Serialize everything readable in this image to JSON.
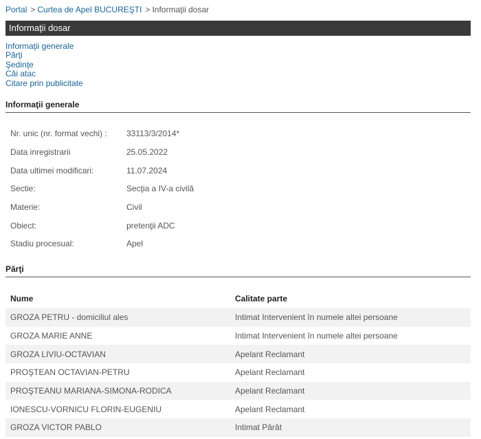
{
  "breadcrumb": {
    "portal": "Portal",
    "separator": ">",
    "court": "Curtea de Apel BUCUREŞTI",
    "current": "Informaţii dosar"
  },
  "title": "Informaţii dosar",
  "quick_links": [
    "Informaţii generale",
    "Părţi",
    "Şedinţe",
    "Căi atac",
    "Citare prin publicitate"
  ],
  "general": {
    "heading": "Informaţii generale",
    "rows": [
      {
        "label": "Nr. unic (nr. format vechi) :",
        "value": "33113/3/2014*"
      },
      {
        "label": "Data inregistrarii",
        "value": "25.05.2022"
      },
      {
        "label": "Data ultimei modificari:",
        "value": "11.07.2024"
      },
      {
        "label": "Sectie:",
        "value": "Secţia a IV-a civilă"
      },
      {
        "label": "Materie:",
        "value": "Civil"
      },
      {
        "label": "Obiect:",
        "value": "pretenţii ADC"
      },
      {
        "label": "Stadiu procesual:",
        "value": "Apel"
      }
    ]
  },
  "parti": {
    "heading": "Părţi",
    "columns": [
      "Nume",
      "Calitate parte"
    ],
    "rows": [
      {
        "name": "GROZA PETRU - domiciliul ales",
        "role": "Intimat Intervenient în numele altei persoane"
      },
      {
        "name": "GROZA MARIE ANNE",
        "role": "Intimat Intervenient în numele altei persoane"
      },
      {
        "name": "GROZA LIVIU-OCTAVIAN",
        "role": "Apelant Reclamant"
      },
      {
        "name": "PROŞTEAN OCTAVIAN-PETRU",
        "role": "Apelant Reclamant"
      },
      {
        "name": "PROŞTEANU MARIANA-SIMONA-RODICA",
        "role": "Apelant Reclamant"
      },
      {
        "name": "IONESCU-VORNICU FLORIN-EUGENIU",
        "role": "Apelant Reclamant"
      },
      {
        "name": "GROZA VICTOR PABLO",
        "role": "Intimat Pârât"
      }
    ]
  },
  "colors": {
    "link": "#1a6496",
    "title_bar_bg": "#3a3a3a",
    "row_stripe": "#f2f2f2"
  }
}
